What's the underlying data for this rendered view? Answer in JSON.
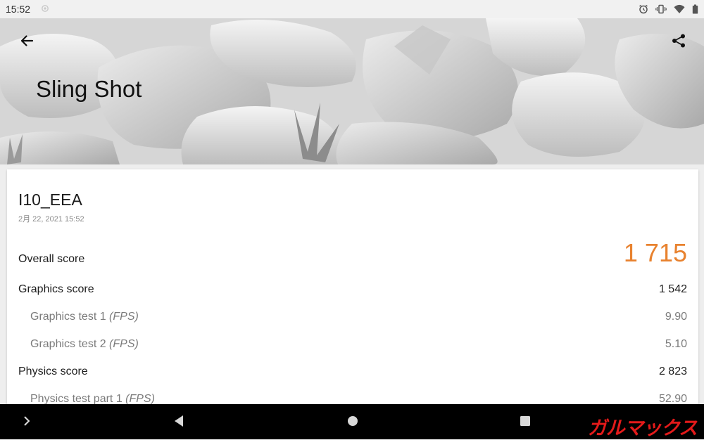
{
  "status_bar": {
    "time": "15:52",
    "icons": [
      "settings-icon",
      "alarm-icon",
      "vibrate-icon",
      "wifi-icon",
      "battery-icon"
    ]
  },
  "header": {
    "title": "Sling Shot",
    "back_icon": "arrow-left-icon",
    "share_icon": "share-icon"
  },
  "result": {
    "device_name": "I10_EEA",
    "date": "2月 22, 2021 15:52",
    "overall": {
      "label": "Overall score",
      "value": "1 715"
    },
    "graphics": {
      "label": "Graphics score",
      "value": "1 542",
      "tests": [
        {
          "label": "Graphics test 1 ",
          "unit": "(FPS)",
          "value": "9.90"
        },
        {
          "label": "Graphics test 2 ",
          "unit": "(FPS)",
          "value": "5.10"
        }
      ]
    },
    "physics": {
      "label": "Physics score",
      "value": "2 823",
      "tests": [
        {
          "label": "Physics test part 1 ",
          "unit": "(FPS)",
          "value": "52.90"
        }
      ]
    }
  },
  "nav_bar": {
    "buttons": [
      "chevron-right-icon",
      "back-triangle-icon",
      "home-circle-icon",
      "recents-square-icon"
    ],
    "watermark": "ガルマックス"
  },
  "colors": {
    "overall_score": "#e8822f",
    "watermark": "#e31a1a",
    "nav_background": "#000000"
  }
}
